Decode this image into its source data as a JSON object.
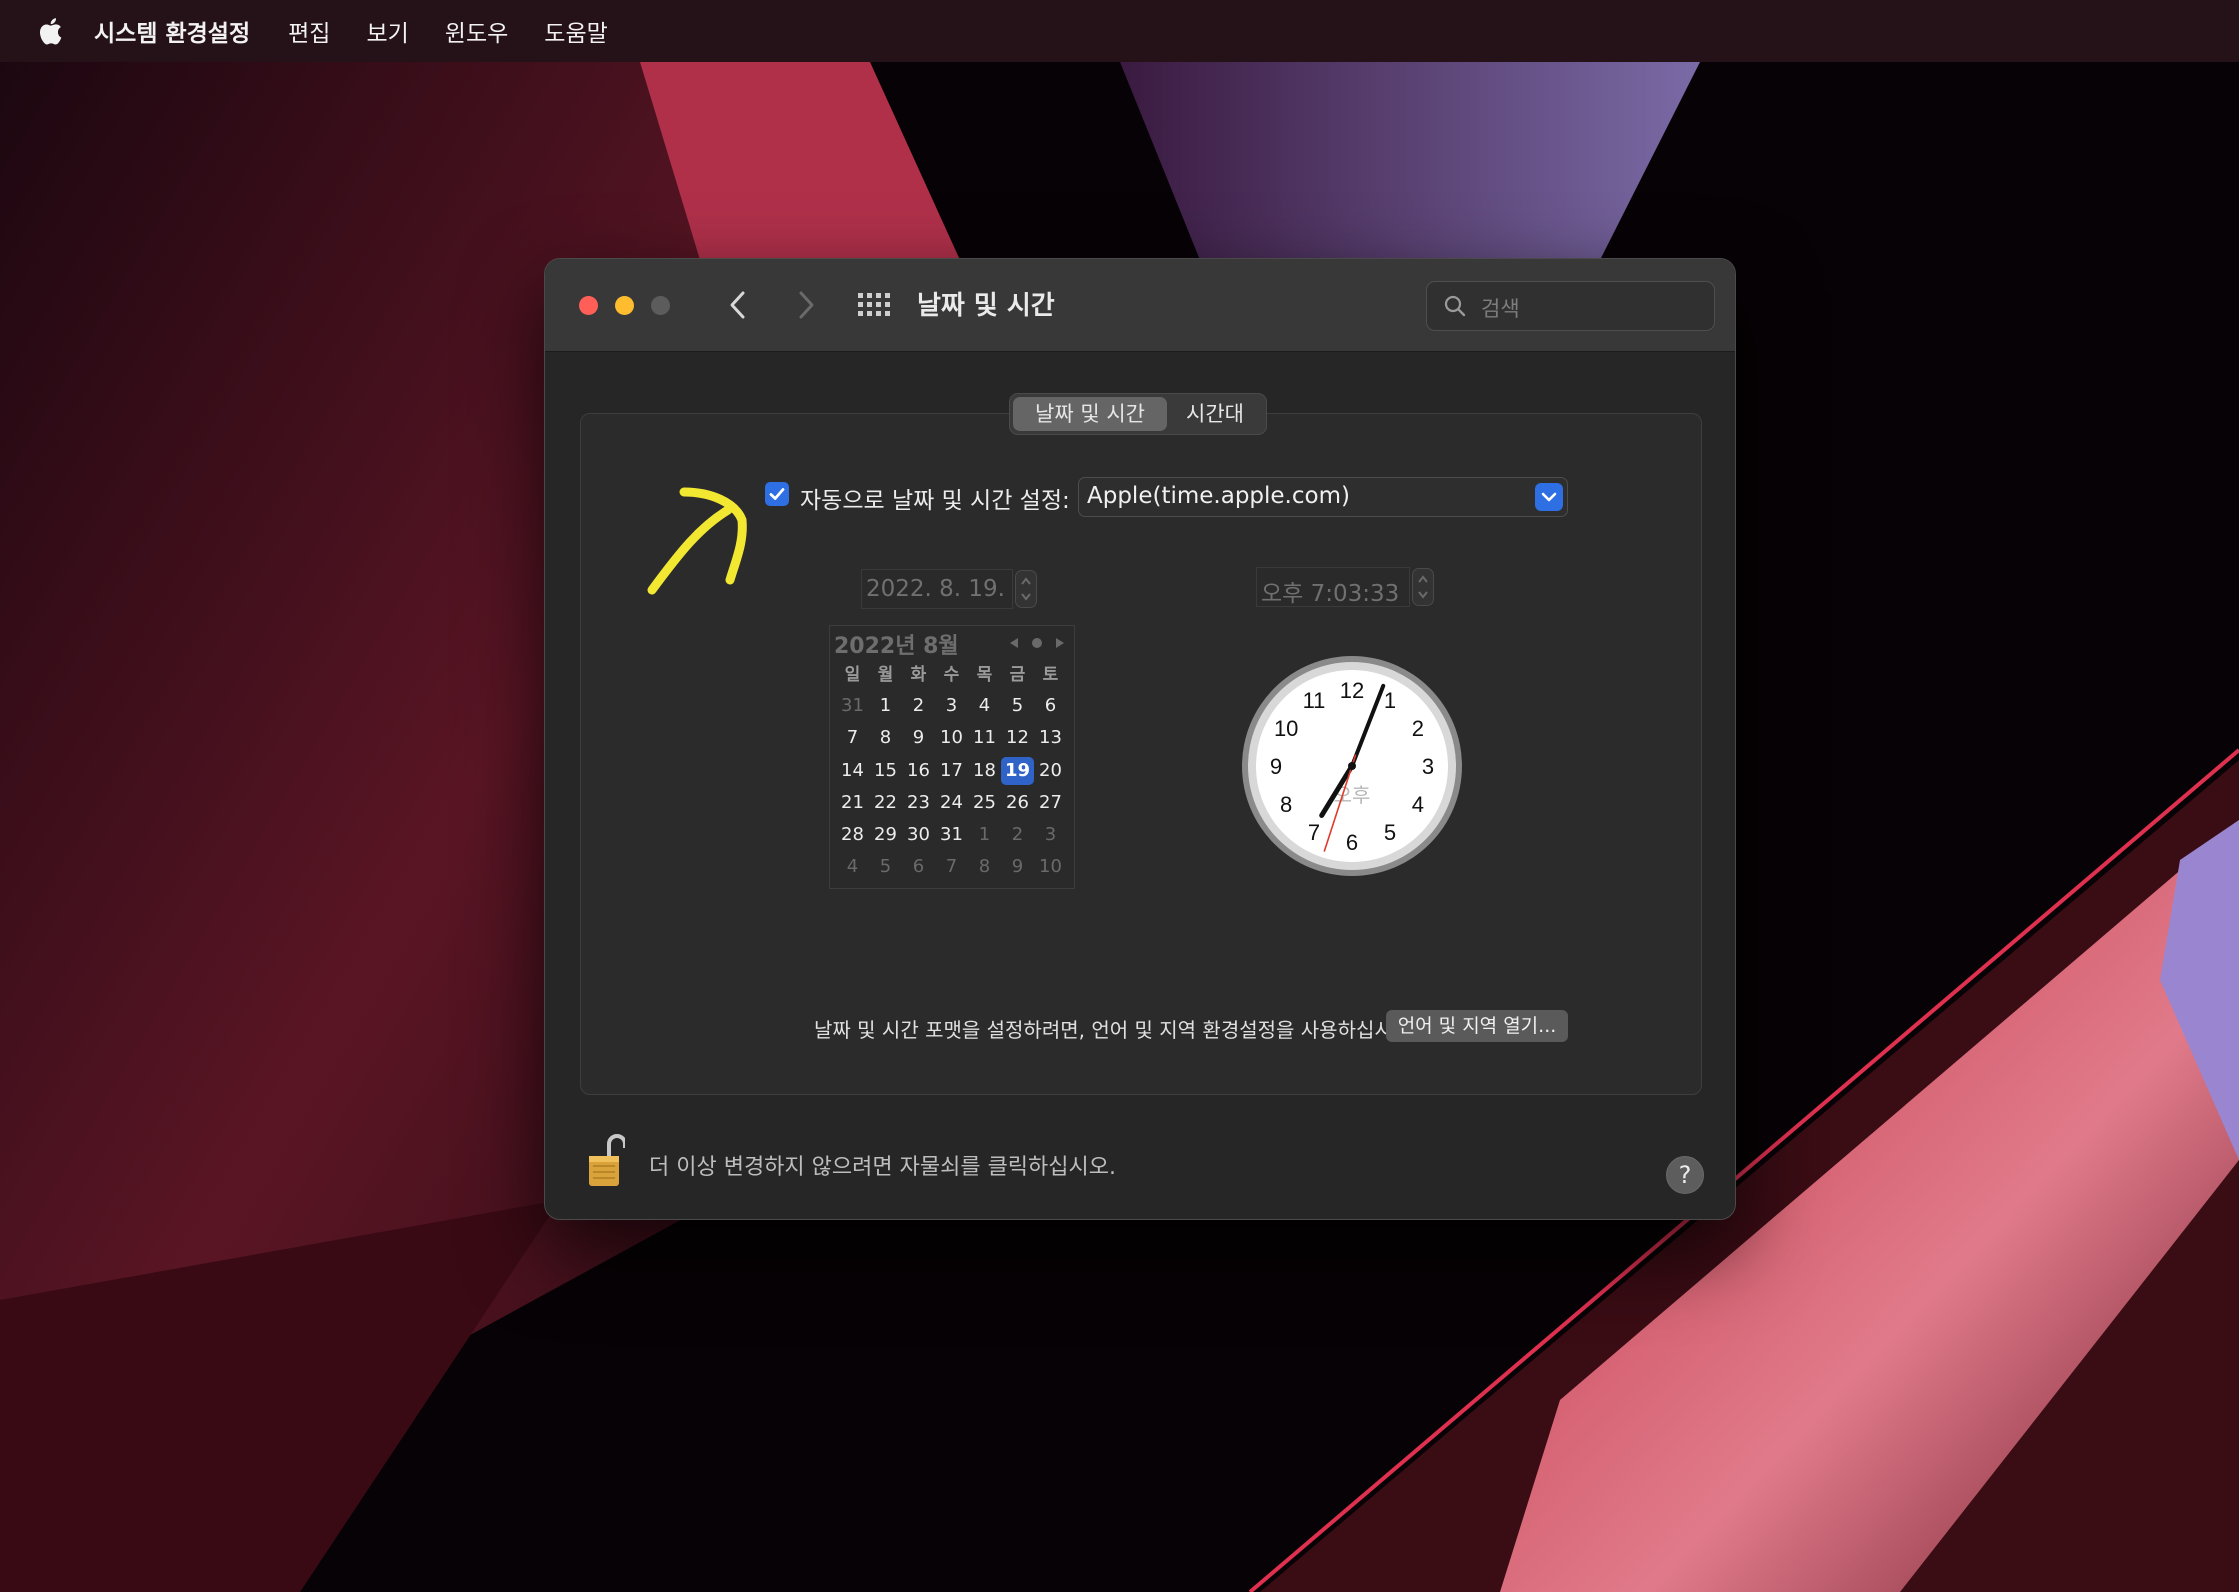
{
  "menubar": {
    "app_name": "시스템 환경설정",
    "items": [
      "편집",
      "보기",
      "윈도우",
      "도움말"
    ]
  },
  "window": {
    "title": "날짜 및 시간",
    "search_placeholder": "검색"
  },
  "tabs": [
    {
      "label": "날짜 및 시간",
      "active": true
    },
    {
      "label": "시간대",
      "active": false
    }
  ],
  "auto_set": {
    "checked": true,
    "label": "자동으로 날짜 및 시간 설정:",
    "server": "Apple(time.apple.com)"
  },
  "date_field": "2022.  8. 19.",
  "time_field": "오후   7:03:33",
  "calendar": {
    "header": "2022년 8월",
    "weekdays": [
      "일",
      "월",
      "화",
      "수",
      "목",
      "금",
      "토"
    ],
    "weeks": [
      [
        "31",
        "1",
        "2",
        "3",
        "4",
        "5",
        "6"
      ],
      [
        "7",
        "8",
        "9",
        "10",
        "11",
        "12",
        "13"
      ],
      [
        "14",
        "15",
        "16",
        "17",
        "18",
        "19",
        "20"
      ],
      [
        "21",
        "22",
        "23",
        "24",
        "25",
        "26",
        "27"
      ],
      [
        "28",
        "29",
        "30",
        "31",
        "1",
        "2",
        "3"
      ],
      [
        "4",
        "5",
        "6",
        "7",
        "8",
        "9",
        "10"
      ]
    ],
    "selected_day": "19"
  },
  "clock": {
    "numbers": [
      "12",
      "1",
      "2",
      "3",
      "4",
      "5",
      "6",
      "7",
      "8",
      "9",
      "10",
      "11"
    ],
    "ampm": "오후",
    "hour": 7,
    "minute": 3,
    "second": 33
  },
  "format_note": "날짜 및 시간 포맷을 설정하려면, 언어 및 지역 환경설정을 사용하십시오.",
  "open_button": "언어 및 지역 열기...",
  "lock_text": "더 이상 변경하지 않으려면 자물쇠를 클릭하십시오.",
  "help_label": "?",
  "colors": {
    "accent": "#2f6fe4",
    "annotation": "#f2e832"
  }
}
